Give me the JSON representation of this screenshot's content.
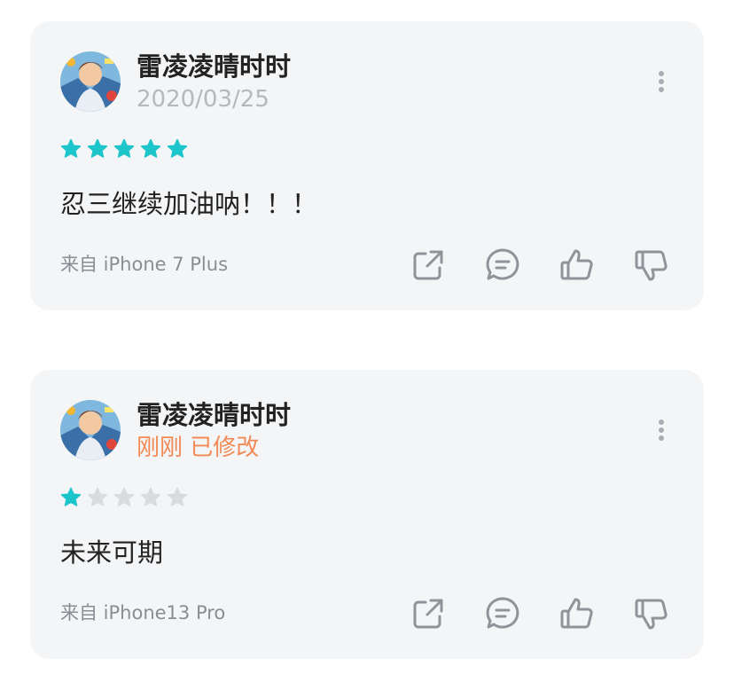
{
  "colors": {
    "star_on": "#1cc5c9",
    "star_off": "#d9dcdf",
    "status": "#f28a55",
    "icon": "#8f939a"
  },
  "reviews": [
    {
      "author": "雷凌凌晴时时",
      "meta": "2020/03/25",
      "rating": 5,
      "max_rating": 5,
      "text": "忍三继续加油呐！！！",
      "device": "来自 iPhone 7 Plus",
      "more_icon": "more-vertical-icon"
    },
    {
      "author": "雷凌凌晴时时",
      "meta": "刚刚 已修改",
      "rating": 1,
      "max_rating": 5,
      "text": "未来可期",
      "device": "来自 iPhone13 Pro",
      "more_icon": "more-vertical-icon"
    }
  ],
  "action_icons": [
    "share-icon",
    "comment-icon",
    "thumbs-up-icon",
    "thumbs-down-icon"
  ]
}
